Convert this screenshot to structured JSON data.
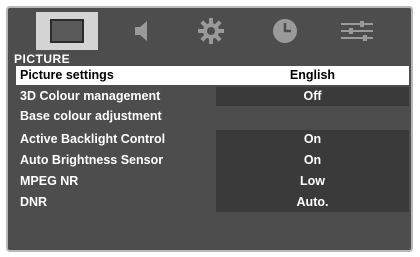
{
  "tabs": [
    {
      "name": "picture-tab",
      "icon": "monitor-icon"
    },
    {
      "name": "sound-tab",
      "icon": "speaker-icon"
    },
    {
      "name": "settings-tab",
      "icon": "gear-icon"
    },
    {
      "name": "clock-tab",
      "icon": "clock-icon"
    },
    {
      "name": "adjustments-tab",
      "icon": "sliders-icon"
    }
  ],
  "menu": {
    "title": "PICTURE",
    "items": [
      {
        "label": "Picture settings",
        "value": "English"
      },
      {
        "label": "3D Colour management",
        "value": "Off"
      },
      {
        "label": "Base colour adjustment",
        "value": ""
      },
      {
        "label": "Active Backlight Control",
        "value": "On"
      },
      {
        "label": "Auto Brightness Sensor",
        "value": "On"
      },
      {
        "label": "MPEG NR",
        "value": "Low"
      },
      {
        "label": "DNR",
        "value": "Auto."
      }
    ]
  }
}
